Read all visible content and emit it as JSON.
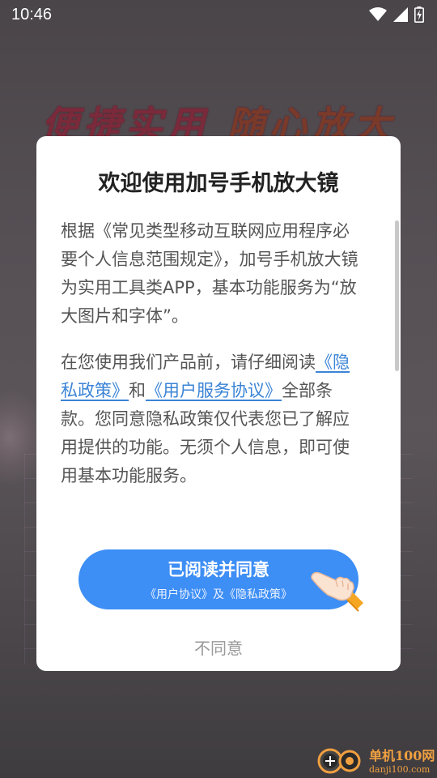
{
  "status_bar": {
    "time": "10:46",
    "icons": [
      "wifi-icon",
      "signal-icon",
      "battery-charging-icon"
    ]
  },
  "background": {
    "slogan_left": "便捷实用",
    "slogan_right": "随心放大"
  },
  "dialog": {
    "title": "欢迎使用加号手机放大镜",
    "paragraph1": "根据《常见类型移动互联网应用程序必要个人信息范围规定》，加号手机放大镜为实用工具类APP，基本功能服务为“放大图片和字体”。",
    "paragraph2_prefix": "在您使用我们产品前，请仔细阅读",
    "privacy_link": "《隐私政策》",
    "connector": "和",
    "service_link": "《用户服务协议》",
    "paragraph2_suffix": "全部条款。您同意隐私政策仅代表您已了解应用提供的功能。无须个人信息，即可使用基本功能服务。",
    "agree_button": {
      "label": "已阅读并同意",
      "sublabel": "《用户协议》及《隐私政策》"
    },
    "disagree_label": "不同意"
  },
  "watermark": {
    "line1": "单机100网",
    "line2": "danji100.com"
  },
  "colors": {
    "accent": "#3d8ef5",
    "link": "#3b84d6",
    "title": "#222222",
    "body_text": "#555555",
    "disagree": "#999999"
  }
}
